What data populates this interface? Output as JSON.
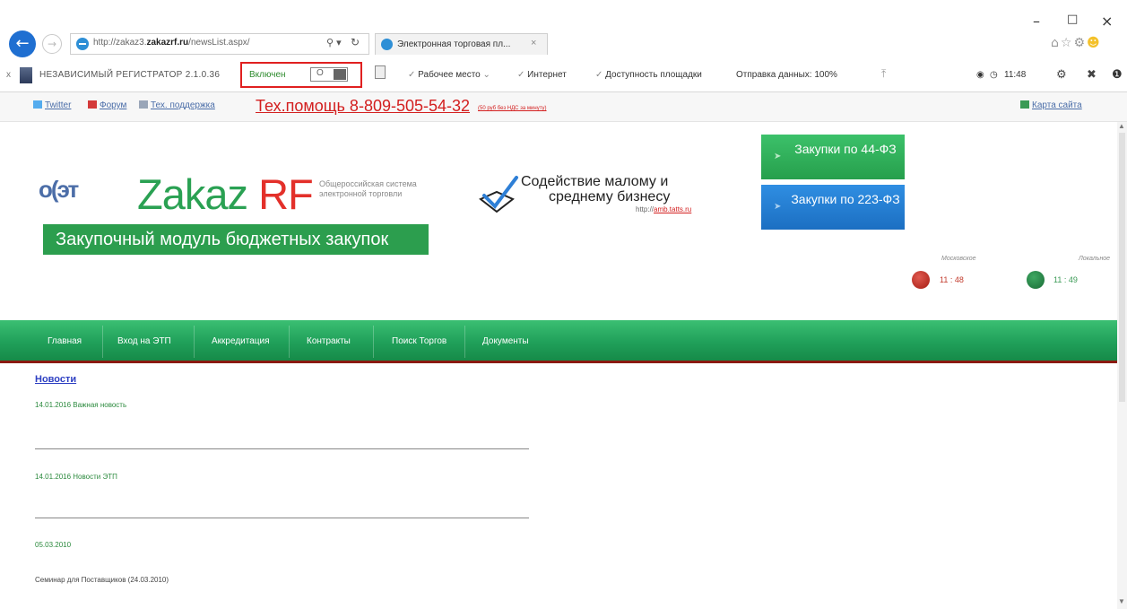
{
  "browser": {
    "address_host_prefix": "http://zakaz3.",
    "address_host_bold": "zakazrf.ru",
    "address_path": "/newsList.aspx/",
    "tab_label": "Электронная торговая пл...",
    "window_controls": [
      "–",
      "□",
      "×"
    ]
  },
  "extension": {
    "close": "x",
    "name": "НЕЗАВИСИМЫЙ РЕГИСТРАТОР 2.1.0.36",
    "status": "Включен",
    "toggle_text": "O",
    "workspace": "Рабочее место",
    "internet": "Интернет",
    "availability": "Доступность площадки",
    "sending": "Отправка данных: 100%",
    "time": "11:48"
  },
  "toplinks": {
    "twitter": "Twitter",
    "forum": "Форум",
    "support": "Тех. поддержка",
    "phone": "Тех.помощь 8-809-505-54-32",
    "phone_note": "(50 руб без НДС за минуту)",
    "sitemap": "Карта сайта"
  },
  "header": {
    "logo_left": "о(эт",
    "logo_word": "Zakaz",
    "logo_rf": "RF",
    "logo_sub": "Общероссийская система электронной торговли",
    "module": "Закупочный модуль бюджетных закупок",
    "sme_line1": "Содействие малому и",
    "sme_line2": "среднему бизнесу",
    "sme_url_prefix": "http://",
    "sme_url_link": "amb.tatts.ru",
    "buy44": "Закупки по 44-ФЗ",
    "buy223": "Закупки по 223-ФЗ",
    "clock_moscow_label": "Московское",
    "clock_moscow_time": "11 : 48",
    "clock_local_label": "Локальное",
    "clock_local_time": "11 : 49"
  },
  "nav": [
    "Главная",
    "Вход на ЭТП",
    "Аккредитация",
    "Контракты",
    "Поиск Торгов",
    "Документы"
  ],
  "content": {
    "title": "Новости",
    "news": [
      "14.01.2016 Важная новость",
      "14.01.2016 Новости ЭТП",
      "05.03.2010"
    ],
    "seminar": "Семинар для Поставщиков (24.03.2010)"
  },
  "colors": {
    "green": "#2aa153",
    "red": "#e3302a",
    "nav_green": "#20a05a",
    "link_blue": "#2d3fc2"
  }
}
